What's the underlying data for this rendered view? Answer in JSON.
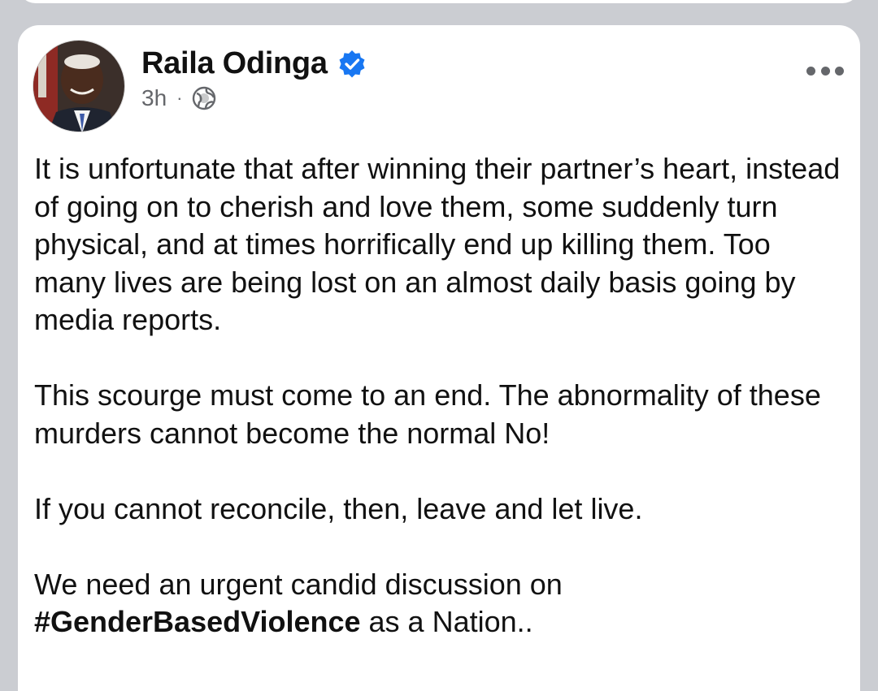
{
  "post": {
    "author": "Raila Odinga",
    "verified": true,
    "timestamp": "3h",
    "separator": "·",
    "audience_icon": "globe-icon",
    "more_icon": "more-options-icon",
    "paragraphs": [
      "It is unfortunate that after winning their partner’s heart, instead of going on to cherish and love them, some suddenly turn physical, and at times horrifically end up killing them. Too many lives are being lost on an almost daily basis going by media reports.",
      "This scourge must come to an end. The abnormality of these murders cannot become the normal No!",
      "If you cannot reconcile, then, leave and let live.",
      "We need an urgent candid discussion on"
    ],
    "hashtag": "#GenderBasedViolence",
    "closing": " as a Nation.."
  },
  "colors": {
    "background": "#cbcdd2",
    "card": "#ffffff",
    "text": "#111111",
    "secondary_text": "#65676b",
    "verified_badge": "#1877f2"
  }
}
